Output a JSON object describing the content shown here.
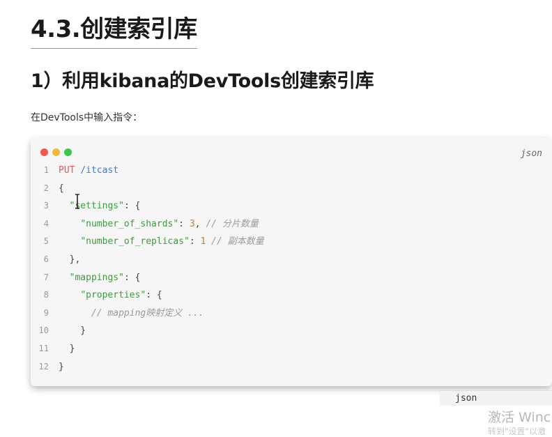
{
  "heading": {
    "h1": "4.3.创建索引库",
    "h2": "1）利用kibana的DevTools创建索引库"
  },
  "paragraph": "在DevTools中输入指令：",
  "code_block": {
    "language_label": "json",
    "window_dots": [
      "#ee5a52",
      "#f5b937",
      "#3ec54a"
    ],
    "lines": [
      {
        "n": "1",
        "tokens": [
          {
            "t": "PUT ",
            "c": "kw"
          },
          {
            "t": "/itcast",
            "c": "path"
          }
        ]
      },
      {
        "n": "2",
        "tokens": [
          {
            "t": "{",
            "c": "punc"
          }
        ]
      },
      {
        "n": "3",
        "tokens": [
          {
            "t": "  ",
            "c": "punc"
          },
          {
            "t": "\"settings\"",
            "c": "str"
          },
          {
            "t": ": {",
            "c": "punc"
          }
        ]
      },
      {
        "n": "4",
        "tokens": [
          {
            "t": "    ",
            "c": "punc"
          },
          {
            "t": "\"number_of_shards\"",
            "c": "str"
          },
          {
            "t": ": ",
            "c": "punc"
          },
          {
            "t": "3",
            "c": "num"
          },
          {
            "t": ", ",
            "c": "punc"
          },
          {
            "t": "// 分片数量",
            "c": "cmt"
          }
        ]
      },
      {
        "n": "5",
        "tokens": [
          {
            "t": "    ",
            "c": "punc"
          },
          {
            "t": "\"number_of_replicas\"",
            "c": "str"
          },
          {
            "t": ": ",
            "c": "punc"
          },
          {
            "t": "1",
            "c": "num"
          },
          {
            "t": " ",
            "c": "punc"
          },
          {
            "t": "// 副本数量",
            "c": "cmt"
          }
        ]
      },
      {
        "n": "6",
        "tokens": [
          {
            "t": "  },",
            "c": "punc"
          }
        ]
      },
      {
        "n": "7",
        "tokens": [
          {
            "t": "  ",
            "c": "punc"
          },
          {
            "t": "\"mappings\"",
            "c": "str"
          },
          {
            "t": ": {",
            "c": "punc"
          }
        ]
      },
      {
        "n": "8",
        "tokens": [
          {
            "t": "    ",
            "c": "punc"
          },
          {
            "t": "\"properties\"",
            "c": "str"
          },
          {
            "t": ": {",
            "c": "punc"
          }
        ]
      },
      {
        "n": "9",
        "tokens": [
          {
            "t": "      ",
            "c": "punc"
          },
          {
            "t": "// mapping映射定义 ...",
            "c": "cmt"
          }
        ]
      },
      {
        "n": "10",
        "tokens": [
          {
            "t": "    }",
            "c": "punc"
          }
        ]
      },
      {
        "n": "11",
        "tokens": [
          {
            "t": "  }",
            "c": "punc"
          }
        ]
      },
      {
        "n": "12",
        "tokens": [
          {
            "t": "}",
            "c": "punc"
          }
        ]
      }
    ]
  },
  "language_select": {
    "value": "json"
  },
  "watermark": {
    "line1": "激活 Winc",
    "line2": "转到\"设置\"以激"
  }
}
